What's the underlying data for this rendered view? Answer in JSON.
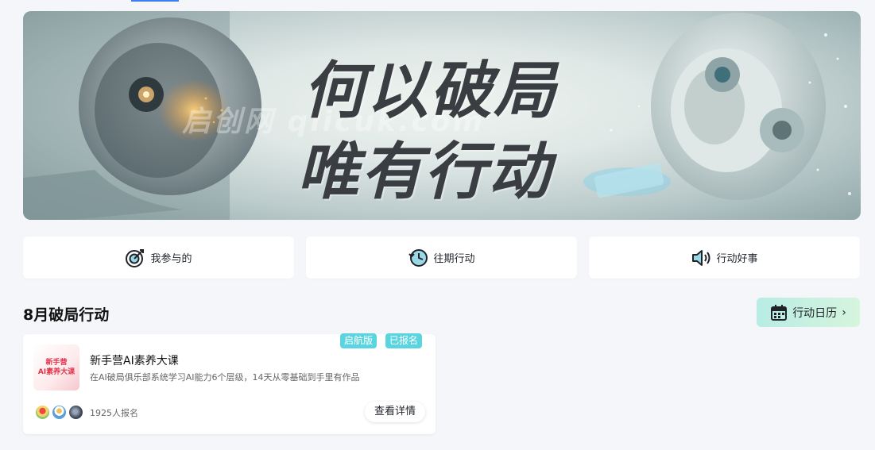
{
  "banner": {
    "line1": "何以破局",
    "line2": "唯有行动",
    "watermark": "启创网 qiicuk.com"
  },
  "quick_nav": [
    {
      "label": "我参与的",
      "icon": "target-icon"
    },
    {
      "label": "往期行动",
      "icon": "history-clock-icon"
    },
    {
      "label": "行动好事",
      "icon": "speaker-icon"
    }
  ],
  "section": {
    "title": "8月破局行动",
    "calendar_button": "行动日历",
    "calendar_icon": "calendar-icon"
  },
  "course": {
    "badges": [
      "启航版",
      "已报名"
    ],
    "thumb_line1": "新手营",
    "thumb_line2": "AI素养大课",
    "title": "新手营AI素养大课",
    "description": "在AI破局俱乐部系统学习AI能力6个层级，14天从零基础到手里有作品",
    "signup_count": "1925人报名",
    "detail_button": "查看详情"
  },
  "colors": {
    "badge": "#5ad5df",
    "accent": "#3b7ff0",
    "calendar_gradient_start": "#b8ece4",
    "calendar_gradient_end": "#d6f5dd"
  }
}
